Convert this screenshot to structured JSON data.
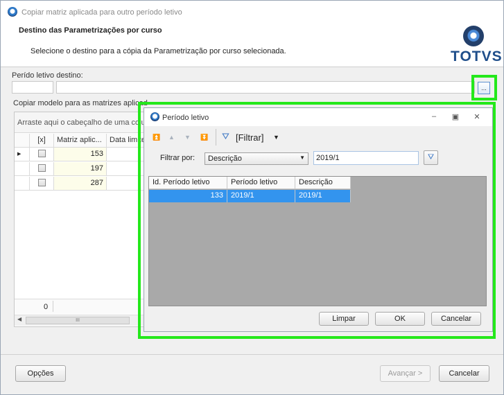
{
  "window": {
    "title": "Copiar matriz aplicada para outro período letivo"
  },
  "header": {
    "title": "Destino das Parametrizações por curso",
    "subtitle": "Selecione o destino para a cópia da Parametrização por curso selecionada.",
    "logo_text": "TOTVS"
  },
  "form": {
    "periodo_label": "Perído letivo destino:",
    "periodo_code": "",
    "periodo_desc": "",
    "lookup_label": "...",
    "copiar_label": "Copiar modelo para as matrizes aplicad"
  },
  "grid": {
    "group_hint": "Arraste aqui o cabeçalho de uma colu",
    "headers": [
      "[x]",
      "Matriz aplic...",
      "Data limite"
    ],
    "rows": [
      {
        "matriz": "153"
      },
      {
        "matriz": "197"
      },
      {
        "matriz": "287"
      }
    ],
    "footer_count": "0",
    "scroll_grip": "III"
  },
  "footer": {
    "opcoes": "Opções",
    "avancar": "Avançar >",
    "cancelar": "Cancelar"
  },
  "popup": {
    "title": "Período letivo",
    "filter_button": "[Filtrar]",
    "filter_by_label": "Filtrar por:",
    "filter_field": "Descrição",
    "filter_value": "2019/1",
    "columns": [
      "Id. Período letivo",
      "Período letivo",
      "Descrição"
    ],
    "rows": [
      {
        "id": "133",
        "periodo": "2019/1",
        "descricao": "2019/1"
      }
    ],
    "buttons": {
      "limpar": "Limpar",
      "ok": "OK",
      "cancelar": "Cancelar"
    }
  },
  "colors": {
    "highlight": "#24e81b",
    "selection": "#3394ee",
    "brand": "#1f4e8a"
  }
}
